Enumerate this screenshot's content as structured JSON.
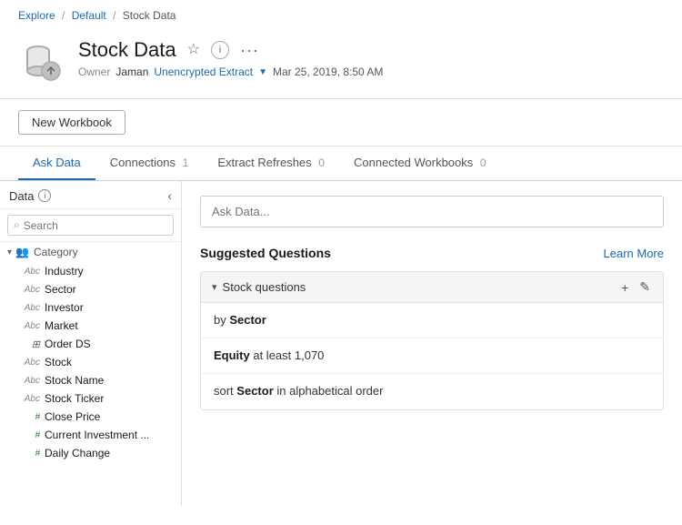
{
  "breadcrumb": {
    "explore": "Explore",
    "default": "Default",
    "current": "Stock Data"
  },
  "header": {
    "title": "Stock Data",
    "owner_label": "Owner",
    "owner_name": "Jaman",
    "extract_text": "Unencrypted Extract",
    "timestamp": "Mar 25, 2019, 8:50 AM"
  },
  "buttons": {
    "new_workbook": "New Workbook"
  },
  "tabs": [
    {
      "label": "Ask Data",
      "badge": "",
      "active": true
    },
    {
      "label": "Connections",
      "badge": "1",
      "active": false
    },
    {
      "label": "Extract Refreshes",
      "badge": "0",
      "active": false
    },
    {
      "label": "Connected Workbooks",
      "badge": "0",
      "active": false
    }
  ],
  "sidebar": {
    "title": "Data",
    "search_placeholder": "Search",
    "category": {
      "name": "Category",
      "items": [
        {
          "type": "Abc",
          "name": "Industry"
        },
        {
          "type": "Abc",
          "name": "Sector"
        }
      ]
    },
    "items": [
      {
        "type": "Abc",
        "name": "Investor"
      },
      {
        "type": "Abc",
        "name": "Market"
      },
      {
        "type": "db",
        "name": "Order DS"
      },
      {
        "type": "Abc",
        "name": "Stock"
      },
      {
        "type": "Abc",
        "name": "Stock Name"
      },
      {
        "type": "Abc",
        "name": "Stock Ticker"
      },
      {
        "type": "#",
        "name": "Close Price"
      },
      {
        "type": "#",
        "name": "Current Investment ..."
      },
      {
        "type": "#",
        "name": "Daily Change"
      }
    ]
  },
  "content": {
    "ask_placeholder": "Ask Data...",
    "suggested_title": "Suggested Questions",
    "learn_more": "Learn More",
    "group_name": "Stock questions",
    "questions": [
      {
        "text": "by Sector",
        "bold_parts": [
          "Sector"
        ]
      },
      {
        "text": "Equity at least 1,070",
        "bold_parts": [
          "Equity"
        ]
      },
      {
        "text": "sort Sector in alphabetical order",
        "bold_parts": [
          "Sector"
        ]
      }
    ]
  },
  "icons": {
    "star": "☆",
    "info": "ⓘ",
    "more": "•••",
    "chevron_down": "▼",
    "search": "🔍",
    "collapse": "‹",
    "plus": "+",
    "pencil": "✎",
    "expand_down": "›"
  }
}
